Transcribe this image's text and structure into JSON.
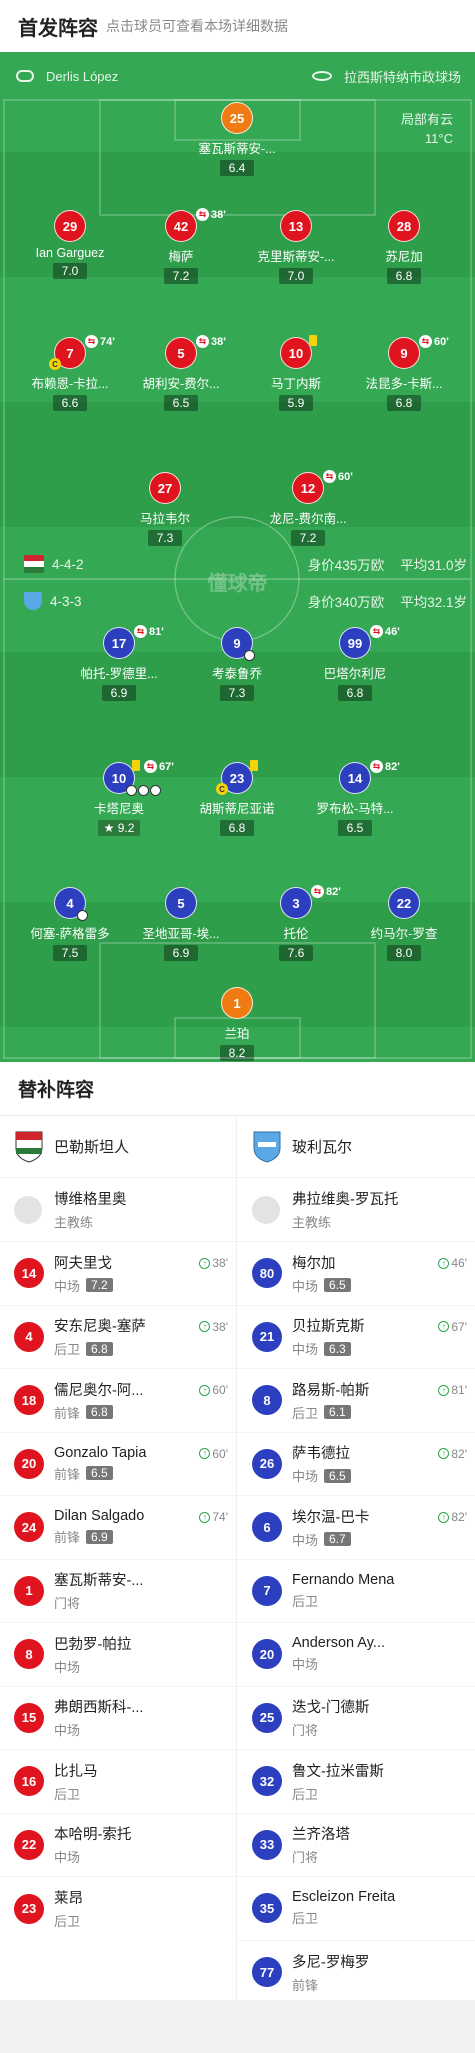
{
  "header": {
    "title": "首发阵容",
    "subtitle": "点击球员可查看本场详细数据"
  },
  "info": {
    "referee": "Derlis López",
    "stadium": "拉西斯特纳市政球场",
    "weather": "局部有云",
    "temperature": "11°C"
  },
  "watermark": "懂球帝",
  "teams": {
    "home": {
      "formation": "4-4-2",
      "value": "身价435万欧",
      "age": "平均31.0岁",
      "name": "巴勒斯坦人",
      "coach": "博维格里奥",
      "coach_role": "主教练"
    },
    "away": {
      "formation": "4-3-3",
      "value": "身价340万欧",
      "age": "平均32.1岁",
      "name": "玻利瓦尔",
      "coach": "弗拉维奥-罗瓦托",
      "coach_role": "主教练"
    }
  },
  "home_players": [
    {
      "num": "25",
      "name": "塞瓦斯蒂安-...",
      "rating": "6.4"
    },
    {
      "num": "29",
      "name": "Ian Garguez",
      "rating": "7.0"
    },
    {
      "num": "42",
      "name": "梅萨",
      "rating": "7.2",
      "sub": "38'"
    },
    {
      "num": "13",
      "name": "克里斯蒂安-...",
      "rating": "7.0"
    },
    {
      "num": "28",
      "name": "苏尼加",
      "rating": "6.8"
    },
    {
      "num": "7",
      "name": "布赖恩-卡拉...",
      "rating": "6.6",
      "sub": "74'"
    },
    {
      "num": "5",
      "name": "胡利安-费尔...",
      "rating": "6.5",
      "sub": "38'"
    },
    {
      "num": "10",
      "name": "马丁内斯",
      "rating": "5.9"
    },
    {
      "num": "9",
      "name": "法昆多-卡斯...",
      "rating": "6.8",
      "sub": "60'"
    },
    {
      "num": "27",
      "name": "马拉韦尔",
      "rating": "7.3"
    },
    {
      "num": "12",
      "name": "龙尼-费尔南...",
      "rating": "7.2",
      "sub": "60'"
    }
  ],
  "away_players": [
    {
      "num": "17",
      "name": "帕托-罗德里...",
      "rating": "6.9",
      "sub": "81'"
    },
    {
      "num": "9",
      "name": "考泰鲁乔",
      "rating": "7.3"
    },
    {
      "num": "99",
      "name": "巴塔尔利尼",
      "rating": "6.8",
      "sub": "46'"
    },
    {
      "num": "10",
      "name": "卡塔尼奥",
      "rating": "9.2",
      "sub": "67'"
    },
    {
      "num": "23",
      "name": "胡斯蒂尼亚诺",
      "rating": "6.8"
    },
    {
      "num": "14",
      "name": "罗布松-马特...",
      "rating": "6.5",
      "sub": "82'"
    },
    {
      "num": "4",
      "name": "何塞-萨格雷多",
      "rating": "7.5"
    },
    {
      "num": "5",
      "name": "圣地亚哥-埃...",
      "rating": "6.9"
    },
    {
      "num": "3",
      "name": "托伦",
      "rating": "7.6",
      "sub": "82'"
    },
    {
      "num": "22",
      "name": "约马尔-罗查",
      "rating": "8.0"
    },
    {
      "num": "1",
      "name": "兰珀",
      "rating": "8.2"
    }
  ],
  "subs_title": "替补阵容",
  "home_subs": [
    {
      "num": "14",
      "name": "阿夫里戈",
      "pos": "中场",
      "rating": "7.2",
      "min": "38'"
    },
    {
      "num": "4",
      "name": "安东尼奥-塞萨",
      "pos": "后卫",
      "rating": "6.8",
      "min": "38'"
    },
    {
      "num": "18",
      "name": "儒尼奥尔-阿...",
      "pos": "前锋",
      "rating": "6.8",
      "min": "60'"
    },
    {
      "num": "20",
      "name": "Gonzalo Tapia",
      "pos": "前锋",
      "rating": "6.5",
      "min": "60'"
    },
    {
      "num": "24",
      "name": "Dilan Salgado",
      "pos": "前锋",
      "rating": "6.9",
      "min": "74'"
    },
    {
      "num": "1",
      "name": "塞瓦斯蒂安-...",
      "pos": "门将"
    },
    {
      "num": "8",
      "name": "巴勃罗-帕拉",
      "pos": "中场"
    },
    {
      "num": "15",
      "name": "弗朗西斯科-...",
      "pos": "中场"
    },
    {
      "num": "16",
      "name": "比扎马",
      "pos": "后卫"
    },
    {
      "num": "22",
      "name": "本哈明-索托",
      "pos": "中场"
    },
    {
      "num": "23",
      "name": "莱昂",
      "pos": "后卫"
    }
  ],
  "away_subs": [
    {
      "num": "80",
      "name": "梅尔加",
      "pos": "中场",
      "rating": "6.5",
      "min": "46'"
    },
    {
      "num": "21",
      "name": "贝拉斯克斯",
      "pos": "中场",
      "rating": "6.3",
      "min": "67'"
    },
    {
      "num": "8",
      "name": "路易斯-帕斯",
      "pos": "后卫",
      "rating": "6.1",
      "min": "81'"
    },
    {
      "num": "26",
      "name": "萨韦德拉",
      "pos": "中场",
      "rating": "6.5",
      "min": "82'"
    },
    {
      "num": "6",
      "name": "埃尔温-巴卡",
      "pos": "中场",
      "rating": "6.7",
      "min": "82'"
    },
    {
      "num": "7",
      "name": "Fernando Mena",
      "pos": "后卫"
    },
    {
      "num": "20",
      "name": "Anderson Ay...",
      "pos": "中场"
    },
    {
      "num": "25",
      "name": "迭戈-门德斯",
      "pos": "门将"
    },
    {
      "num": "32",
      "name": "鲁文-拉米雷斯",
      "pos": "后卫"
    },
    {
      "num": "33",
      "name": "兰齐洛塔",
      "pos": "门将"
    },
    {
      "num": "35",
      "name": "Escleizon Freita",
      "pos": "后卫"
    },
    {
      "num": "77",
      "name": "多尼-罗梅罗",
      "pos": "前锋"
    }
  ],
  "colors": {
    "home": "#e0141e",
    "away": "#2c3fbf",
    "keeper_home": "#f07b12",
    "pitch": "#34a853"
  }
}
